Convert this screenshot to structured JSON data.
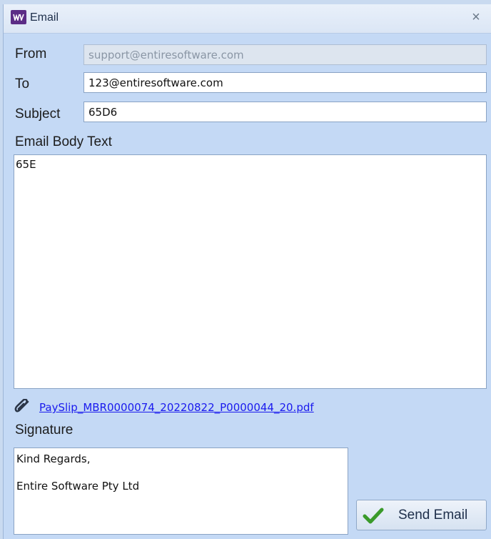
{
  "window": {
    "title": "Email",
    "close_label": "×"
  },
  "form": {
    "from_label": "From",
    "from_value": "support@entiresoftware.com",
    "to_label": "To",
    "to_value": "123@entiresoftware.com",
    "subject_label": "Subject",
    "subject_value": "65D6",
    "body_label": "Email Body Text",
    "body_value": "65E"
  },
  "attachment": {
    "icon": "paperclip-icon",
    "filename": "PaySlip_MBR0000074_20220822_P0000044_20.pdf"
  },
  "signature": {
    "label": "Signature",
    "line1": "Kind Regards,",
    "line2": "Entire Software Pty Ltd"
  },
  "actions": {
    "send_label": "Send Email",
    "send_icon": "checkmark-icon"
  },
  "colors": {
    "window_bg": "#c4d9f5",
    "app_icon_bg": "#5b2c86",
    "link": "#1a1aee",
    "check": "#3a9a2a"
  }
}
